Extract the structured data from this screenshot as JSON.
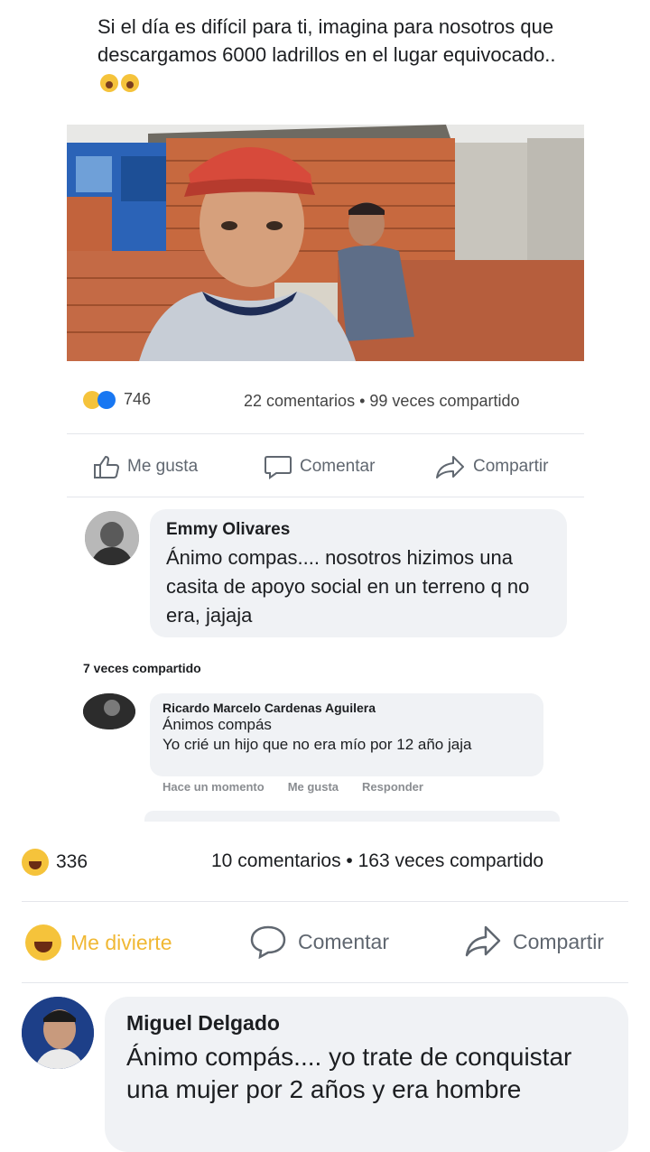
{
  "post": {
    "text": "Si el día es difícil para ti, imagina para nosotros que descargamos 6000 ladrillos en el lugar equivocado.."
  },
  "original_post": {
    "reaction_count": "746",
    "comments": "22 comentarios",
    "shares": "99 veces compartido",
    "actions": {
      "like": "Me gusta",
      "comment": "Comentar",
      "share": "Compartir"
    }
  },
  "comment1": {
    "author": "Emmy Olivares",
    "text": "Ánimo compas.... nosotros hizimos una casita de apoyo social en un terreno q no era, jajaja"
  },
  "shared_count": "7 veces compartido",
  "comment2": {
    "author": "Ricardo Marcelo Cardenas Aguilera",
    "text_line1": "Ánimos compás",
    "text_line2": "Yo crié un hijo que no era mío por 12 año jaja",
    "time": "Hace un momento",
    "like": "Me gusta",
    "reply": "Responder"
  },
  "outer_post": {
    "reaction_count": "336",
    "comments": "10 comentarios",
    "shares": "163 veces compartido",
    "actions": {
      "haha": "Me divierte",
      "comment": "Comentar",
      "share": "Compartir"
    },
    "colors": {
      "haha": "#f0b834",
      "text": "#1c1e21",
      "muted": "#606770"
    }
  },
  "comment3": {
    "author": "Miguel Delgado",
    "text": "Ánimo compás.... yo trate de conquistar una mujer por 2 años y era hombre"
  }
}
